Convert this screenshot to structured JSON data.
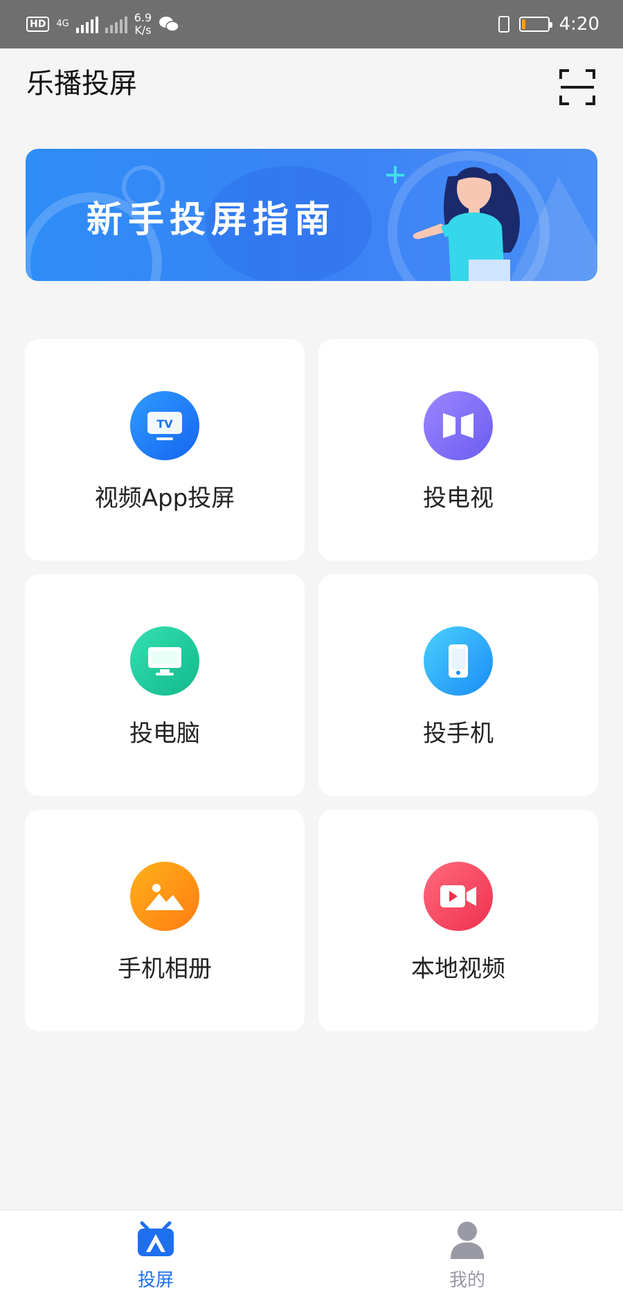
{
  "status_bar": {
    "hd_badge": "HD",
    "network": "4G",
    "net_speed_value": "6.9",
    "net_speed_unit": "K/s",
    "time": "4:20",
    "battery_level_percent": 15,
    "battery_color": "#ff9d00"
  },
  "header": {
    "title": "乐播投屏",
    "scan_icon": "scan-icon"
  },
  "banner": {
    "title": "新手投屏指南"
  },
  "grid": {
    "items": [
      {
        "label": "视频App投屏",
        "icon": "tv-icon",
        "color_from": "#2f9bff",
        "color_to": "#1565f0"
      },
      {
        "label": "投电视",
        "icon": "mirror-icon",
        "color_from": "#9b86ff",
        "color_to": "#6c5cf0"
      },
      {
        "label": "投电脑",
        "icon": "monitor-icon",
        "color_from": "#35e0b0",
        "color_to": "#12b88a"
      },
      {
        "label": "投手机",
        "icon": "phone-icon",
        "color_from": "#4ad0ff",
        "color_to": "#1a8cf5"
      },
      {
        "label": "手机相册",
        "icon": "photo-icon",
        "color_from": "#ffb21a",
        "color_to": "#ff7b12"
      },
      {
        "label": "本地视频",
        "icon": "video-camera-icon",
        "color_from": "#ff6a7d",
        "color_to": "#f0304f"
      }
    ]
  },
  "bottom_nav": {
    "tabs": [
      {
        "label": "投屏",
        "active": true
      },
      {
        "label": "我的",
        "active": false
      }
    ],
    "active_color": "#1e6ff0",
    "inactive_color": "#9a9aa5"
  }
}
